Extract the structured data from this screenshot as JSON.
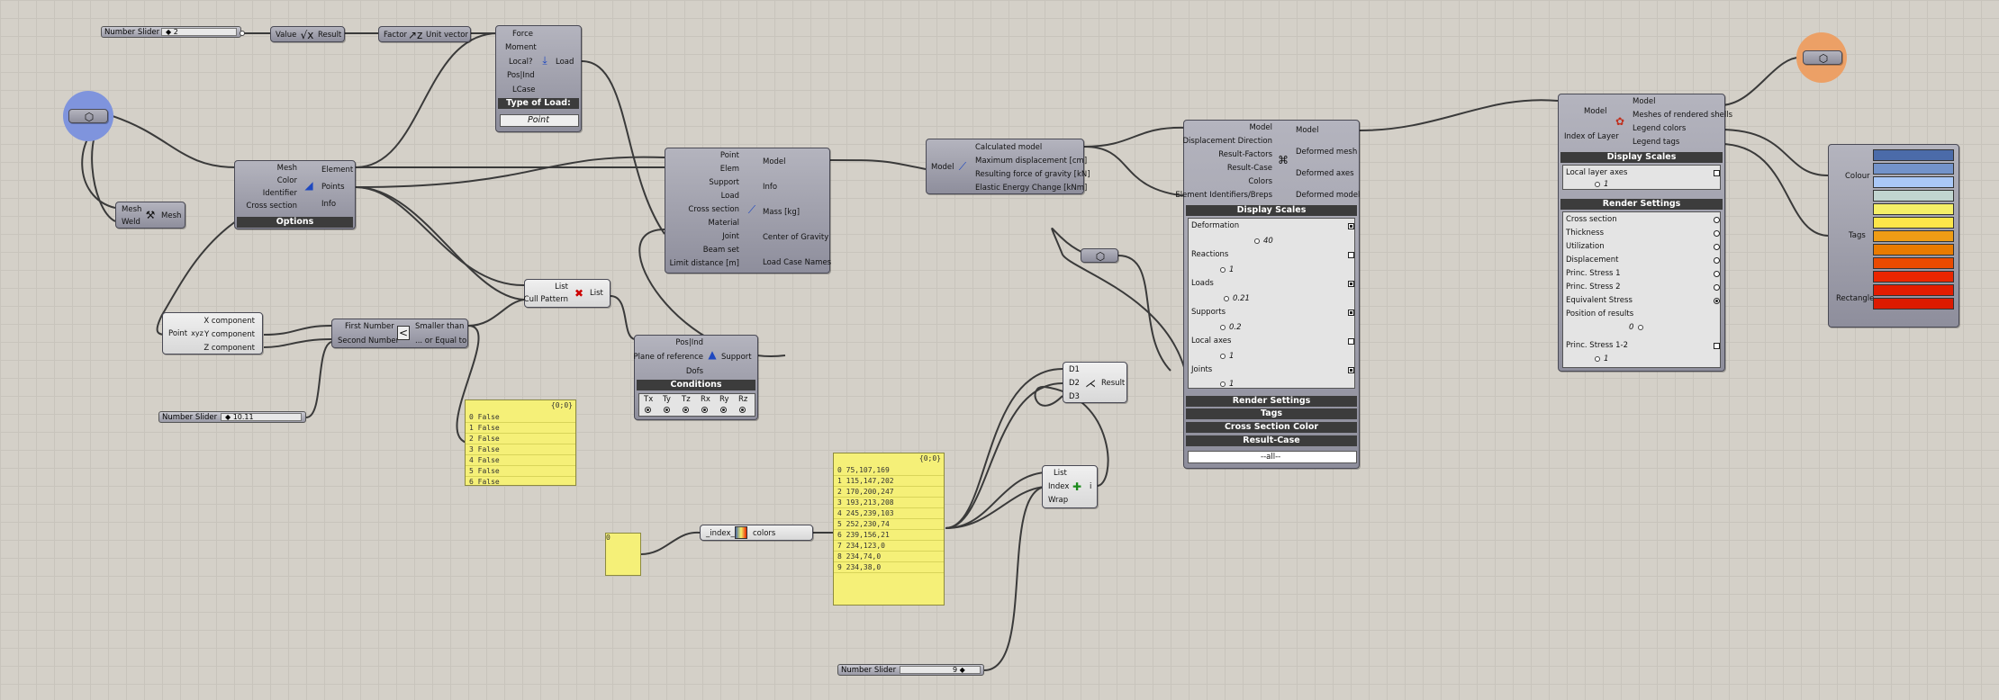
{
  "sliders": {
    "s1": {
      "label": "Number Slider",
      "value": "◆ 2"
    },
    "s2": {
      "label": "Number Slider",
      "value": "◆ 10.11"
    },
    "s3": {
      "label": "Number Slider",
      "value": "9 ◆"
    }
  },
  "value_node": {
    "in": "Value",
    "out": "Result"
  },
  "unit_vector": {
    "in": "Factor",
    "out": "Unit vector"
  },
  "load": {
    "inputs": [
      "Force",
      "Moment",
      "Local?",
      "Pos|Ind",
      "LCase"
    ],
    "output": "Load",
    "header": "Type of Load:",
    "dropdown": "Point"
  },
  "mesh_node": {
    "inputs": [
      "Mesh",
      "Weld"
    ],
    "output": "Mesh"
  },
  "mesh_to_beam": {
    "inputs": [
      "Mesh",
      "Color",
      "Identifier",
      "Cross section"
    ],
    "outputs": [
      "Element",
      "Points",
      "Info"
    ],
    "header": "Options"
  },
  "deconstruct_point": {
    "input": "Point",
    "outputs": [
      "X component",
      "Y component",
      "Z component"
    ]
  },
  "smaller_than": {
    "inputs": [
      "First Number",
      "Second Number"
    ],
    "outputs": [
      "Smaller than",
      "... or Equal to"
    ]
  },
  "cull": {
    "inputs": [
      "List",
      "Cull Pattern"
    ],
    "output": "List"
  },
  "bool_panel": {
    "header": "{0;0}",
    "rows": [
      "0 False",
      "1 False",
      "2 False",
      "3 False",
      "4 False",
      "5 False",
      "6 False"
    ]
  },
  "support": {
    "inputs": [
      "Pos|Ind",
      "Plane of reference",
      "Dofs"
    ],
    "output": "Support",
    "header": "Conditions",
    "dofs": [
      "Tx",
      "Ty",
      "Tz",
      "Rx",
      "Ry",
      "Rz"
    ]
  },
  "assemble": {
    "inputs": [
      "Point",
      "Elem",
      "Support",
      "Load",
      "Cross section",
      "Material",
      "Joint",
      "Beam set",
      "Limit distance [m]"
    ],
    "outputs": [
      "Model",
      "Info",
      "Mass [kg]",
      "Center of Gravity",
      "Load Case Names"
    ]
  },
  "analysis": {
    "input": "Model",
    "outputs": [
      "Calculated model",
      "Maximum displacement [cm]",
      "Resulting force of gravity [kN]",
      "Elastic Energy Change [kNm]"
    ]
  },
  "zero_panel": {
    "value": "0"
  },
  "gradient": {
    "inputs": [
      "_index_"
    ],
    "output": "colors"
  },
  "colors_panel": {
    "header": "{0;0}",
    "rows": [
      "0 75,107,169",
      "1 115,147,202",
      "2 170,200,247",
      "3 193,213,208",
      "4 245,239,103",
      "5 252,230,74",
      "6 239,156,21",
      "7 234,123,0",
      "8 234,74,0",
      "9 234,38,0"
    ]
  },
  "list_item": {
    "inputs": [
      "List",
      "Index",
      "Wrap"
    ],
    "output": "i"
  },
  "merge": {
    "inputs": [
      "D1",
      "D2",
      "D3"
    ],
    "output": "Result"
  },
  "model_view": {
    "inputs": [
      "Model",
      "Displacement Direction",
      "Result-Factors",
      "Result-Case",
      "Colors",
      "Element Identifiers/Breps"
    ],
    "outputs": [
      "Model",
      "Deformed mesh",
      "Deformed axes",
      "Deformed model"
    ],
    "display_header": "Display Scales",
    "scales": [
      {
        "label": "Deformation",
        "value": "40",
        "checked": true
      },
      {
        "label": "Reactions",
        "value": "1",
        "checked": false
      },
      {
        "label": "Loads",
        "value": "0.21",
        "checked": true
      },
      {
        "label": "Supports",
        "value": "0.2",
        "checked": true
      },
      {
        "label": "Local axes",
        "value": "1",
        "checked": false
      },
      {
        "label": "Joints",
        "value": "1",
        "checked": true
      }
    ],
    "sections": [
      "Render Settings",
      "Tags",
      "Cross Section Color",
      "Result-Case"
    ],
    "case_value": "--all--"
  },
  "shell_view": {
    "inputs": [
      "Model",
      "Index of Layer"
    ],
    "outputs": [
      "Model",
      "Meshes of rendered shells",
      "Legend colors",
      "Legend tags"
    ],
    "display_header": "Display Scales",
    "local_axes": {
      "label": "Local layer axes",
      "value": "1"
    },
    "render_header": "Render Settings",
    "options": [
      "Cross section",
      "Thickness",
      "Utilization",
      "Displacement",
      "Princ. Stress 1",
      "Princ. Stress 2",
      "Equivalent Stress"
    ],
    "selected": 6,
    "position_label": "Position of results",
    "position_value": "0",
    "princ12_label": "Princ. Stress 1-2",
    "princ12_value": "1"
  },
  "legend": {
    "inputs": [
      "Colour",
      "Tags",
      "Rectangle"
    ],
    "swatches": [
      "#4b6ba9",
      "#7393ca",
      "#aac8f7",
      "#c1d5d0",
      "#f5ef67",
      "#fce64a",
      "#ef9c15",
      "#ea7b00",
      "#ea4a00",
      "#ea2600",
      "#e41c00",
      "#dd1a00"
    ]
  }
}
